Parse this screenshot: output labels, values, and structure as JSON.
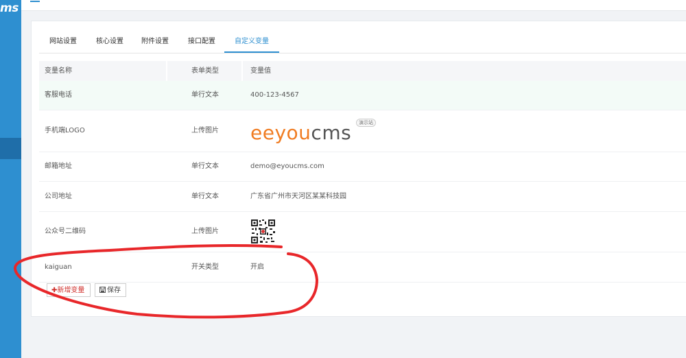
{
  "app": {
    "brand": "ms"
  },
  "tabs": [
    {
      "label": "网站设置"
    },
    {
      "label": "核心设置"
    },
    {
      "label": "附件设置"
    },
    {
      "label": "接口配置"
    },
    {
      "label": "自定义变量",
      "active": true
    }
  ],
  "table": {
    "headers": [
      "变量名称",
      "表单类型",
      "变量值"
    ],
    "rows": [
      {
        "name": "客服电话",
        "type": "单行文本",
        "value": "400-123-4567"
      },
      {
        "name": "手机端LOGO",
        "type": "上传图片",
        "value_image": "eyoucms-logo",
        "logo_parts": [
          "eyou",
          "cms"
        ],
        "badge": "演示站"
      },
      {
        "name": "邮箱地址",
        "type": "单行文本",
        "value": "demo@eyoucms.com"
      },
      {
        "name": "公司地址",
        "type": "单行文本",
        "value": "广东省广州市天河区某某科技园"
      },
      {
        "name": "公众号二维码",
        "type": "上传图片",
        "value_image": "qr-code"
      },
      {
        "name": "kaiguan",
        "type": "开关类型",
        "value": "开启"
      }
    ]
  },
  "actions": {
    "add_label": "新增变量",
    "save_label": "保存"
  },
  "colors": {
    "accent": "#2e8fd0",
    "danger": "#d0312d",
    "annotation": "#e8272a"
  }
}
